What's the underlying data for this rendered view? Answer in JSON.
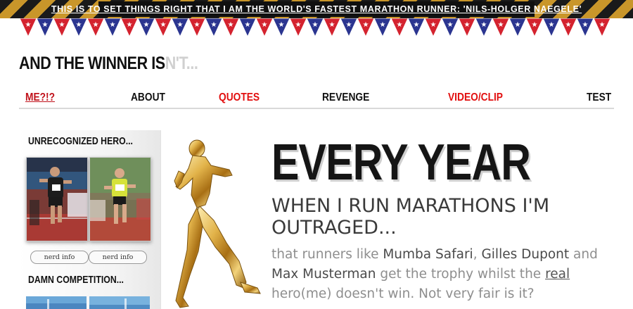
{
  "banner": {
    "text": "THIS IS TO SET THINGS RIGHT THAT I AM THE WORLD'S FASTEST MARATHON RUNNER: 'NILS-HOLGER NAEGELE'"
  },
  "site": {
    "title_main": "AND THE WINNER IS",
    "title_faded": "N'T..."
  },
  "nav": {
    "items": [
      {
        "label": "ME?!?",
        "color": "#c0121b",
        "active": true
      },
      {
        "label": "ABOUT",
        "color": "#111111"
      },
      {
        "label": "QUOTES",
        "color": "#e20f0f"
      },
      {
        "label": "REVENGE",
        "color": "#111111"
      },
      {
        "label": "VIDEO/CLIP",
        "color": "#e20f0f"
      },
      {
        "label": "TEST",
        "color": "#111111"
      }
    ]
  },
  "sidebar": {
    "heading1": "UNRECOGNIZED HERO...",
    "buttons": [
      "nerd info",
      "nerd info"
    ],
    "heading2": "DAMN COMPETITION..."
  },
  "main": {
    "headline": "EVERY YEAR",
    "subhead": "WHEN I RUN MARATHONS I'M OUTRAGED...",
    "body": {
      "part1": "that runners like ",
      "name1": "Mumba Safari",
      "sep1": ", ",
      "name2": "Gilles Dupont",
      "sep2": " and ",
      "name3": "Max Musterman",
      "part2": " get the trophy whilst the ",
      "link": "real",
      "part3": " hero(me) doesn't win. Not very fair is it?"
    }
  },
  "colors": {
    "accent_red": "#e20f0f",
    "flag_red": "#d4232f",
    "flag_blue": "#2b3590",
    "hazard_gold": "#c9962a"
  },
  "icons": {
    "trophy": "gold-runner-trophy-icon",
    "flags": "star-pennant-bunting"
  }
}
